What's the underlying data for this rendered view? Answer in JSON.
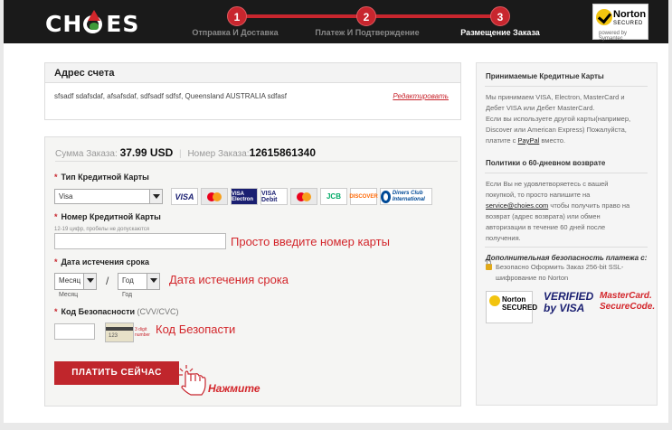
{
  "header": {
    "logo": "CHOIES",
    "steps": [
      {
        "num": "1",
        "label": "Отправка И Доставка"
      },
      {
        "num": "2",
        "label": "Платеж И Подтверждение"
      },
      {
        "num": "3",
        "label": "Размещение Заказа"
      }
    ],
    "norton": {
      "title": "Norton",
      "sub": "SECURED",
      "powered": "powered by Symantec"
    }
  },
  "address": {
    "title": "Адрес счета",
    "text": "sfsadf sdafsdaf, afsafsdaf, sdfsadf sdfsf, Queensland AUSTRALIA sdfasf",
    "edit_link": "Редактировать"
  },
  "summary": {
    "total_label": "Сумма Заказа:",
    "total_value": "37.99 USD",
    "order_label": "Номер Заказа:",
    "order_value": "12615861340"
  },
  "form": {
    "card_type_label": "Тип Кредитной Карты",
    "card_type_value": "Visa",
    "card_number_label": "Номер Кредитной Карты",
    "card_number_hint": "12-19 цифр, пробелы не допускаются",
    "card_number_annot": "Просто введите номер карты",
    "expiry_label": "Дата истечения срока",
    "month_value": "Месяц",
    "month_sub": "Месяц",
    "year_value": "Год",
    "year_sub": "Год",
    "slash": "/",
    "expiry_annot": "Дата истечения срока",
    "cvv_label": "Код Безопасности",
    "cvv_label_hint": "(CVV/CVC)",
    "cvv_note": "3 digit number",
    "cvv_annot": "Код Безопасти",
    "pay_button": "ПЛАТИТЬ СЕЙЧАС",
    "click_annot": "Нажмите"
  },
  "cards": [
    "VISA",
    "MasterCard",
    "VISA Electron",
    "VISA Debit",
    "Debit",
    "JCB",
    "DISCOVER",
    "Diners Club International"
  ],
  "sidebar": {
    "cc_title": "Принимаемые Кредитные Карты",
    "cc_text_1": "Мы принимаем VISA, Electron, MasterCard и Дебет VISA или Дебет MasterCard.",
    "cc_text_2": "Если вы используете другой карты(например, Discover или American Express) Пожалуйста, платите с",
    "cc_paypal": "PayPal",
    "cc_text_3": "вместо.",
    "return_title": "Политики о 60-дневном возврате",
    "return_text_1": "Если Вы не удовлетворяетесь с вашей покупкой, то просто напишите на",
    "return_email": "service@choies.com",
    "return_text_2": "чтобы получить право на возврат (адрес возврата) или обмен авторизации в течение 60 дней после получения.",
    "security_title": "Дополнительная безопасность платежа с:",
    "security_text": "Безопасно Оформить Заказ 256-bit SSL-шифрование по Norton",
    "badges": [
      "Norton SECURED",
      "VERIFIED by VISA",
      "MasterCard. SecureCode."
    ]
  }
}
